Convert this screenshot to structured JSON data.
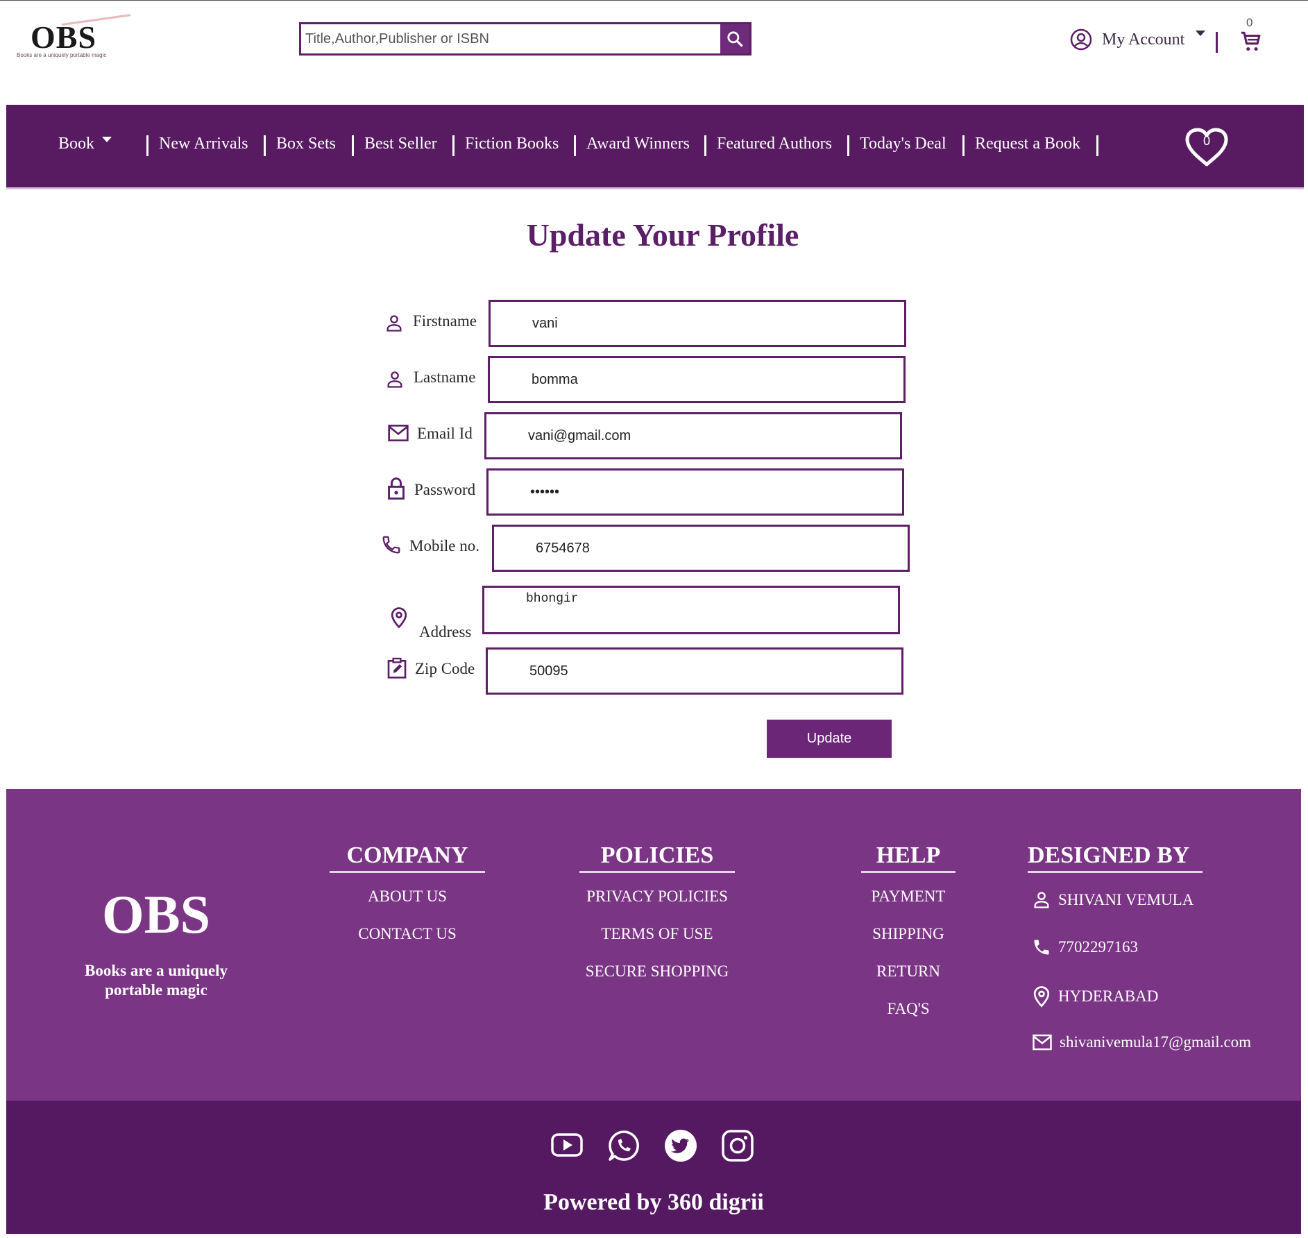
{
  "header": {
    "logo_text": "OBS",
    "logo_tagline": "Books are a uniquely portable magic",
    "search_placeholder": "Title,Author,Publisher or ISBN",
    "account_label": "My Account",
    "cart_count": "0"
  },
  "nav": {
    "items": [
      "Book",
      "New Arrivals",
      "Box Sets",
      "Best Seller",
      "Fiction Books",
      "Award Winners",
      "Featured Authors",
      "Today's Deal",
      "Request a Book"
    ],
    "wishlist_count": "0"
  },
  "form": {
    "title": "Update Your Profile",
    "fields": {
      "firstname": {
        "label": "Firstname",
        "value": "vani",
        "icon": "person-icon"
      },
      "lastname": {
        "label": "Lastname",
        "value": "bomma",
        "icon": "person-icon"
      },
      "email": {
        "label": "Email Id",
        "value": "vani@gmail.com",
        "icon": "mail-icon"
      },
      "password": {
        "label": "Password",
        "value": "••••••",
        "icon": "lock-icon"
      },
      "mobile": {
        "label": "Mobile no.",
        "value": "6754678",
        "icon": "phone-icon"
      },
      "address": {
        "label": "Address",
        "value": "bhongir",
        "icon": "location-pin-icon"
      },
      "zip": {
        "label": "Zip Code",
        "value": "50095",
        "icon": "edit-clipboard-icon"
      }
    },
    "update_label": "Update"
  },
  "footer": {
    "logo_name": "OBS",
    "logo_tagline": "Books are a uniquely portable magic",
    "company": {
      "heading": "COMPANY",
      "links": [
        "ABOUT US",
        "CONTACT US"
      ]
    },
    "policies": {
      "heading": "POLICIES",
      "links": [
        "PRIVACY POLICIES",
        "TERMS OF USE",
        "SECURE SHOPPING"
      ]
    },
    "help": {
      "heading": "HELP",
      "links": [
        "PAYMENT",
        "SHIPPING",
        "RETURN",
        "FAQ'S"
      ]
    },
    "designed_by": {
      "heading": "DESIGNED BY",
      "name": "SHIVANI VEMULA",
      "phone": "7702297163",
      "city": "HYDERABAD",
      "email": "shivanivemula17@gmail.com"
    },
    "social_icons": [
      "youtube-icon",
      "whatsapp-icon",
      "twitter-icon",
      "instagram-icon"
    ],
    "powered_by": "Powered by 360 digrii"
  },
  "colors": {
    "primary": "#581b62",
    "footer": "#7b3585",
    "bottom_bar": "#541960",
    "accent": "#6b2677"
  }
}
